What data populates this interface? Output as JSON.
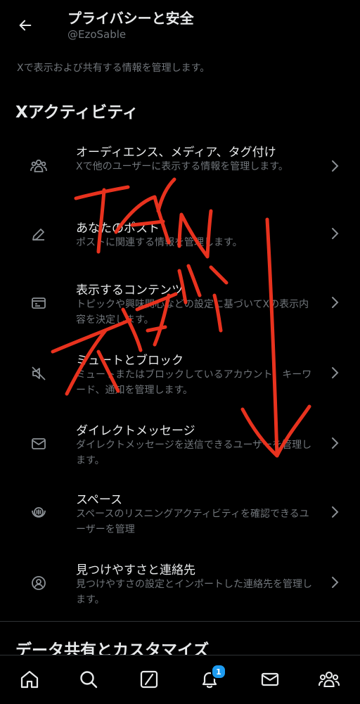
{
  "header": {
    "title": "プライバシーと安全",
    "handle": "@EzoSable"
  },
  "page_description": "Xで表示および共有する情報を管理します。",
  "sections": {
    "activity_title": "Xアクティビティ",
    "data_sharing_title": "データ共有とカスタマイズ"
  },
  "items": [
    {
      "label": "オーディエンス、メディア、タグ付け",
      "desc": "Xで他のユーザーに表示する情報を管理します。",
      "icon": "people-icon"
    },
    {
      "label": "あなたのポスト",
      "desc": "ポストに関連する情報を管理します。",
      "icon": "pencil-icon"
    },
    {
      "label": "表示するコンテンツ",
      "desc": "トピックや興味関心などの設定に基づいてXの表示内容を決定します。",
      "icon": "content-icon"
    },
    {
      "label": "ミュートとブロック",
      "desc": "ミュートまたはブロックしているアカウント、キーワード、通知を管理します。",
      "icon": "mute-icon"
    },
    {
      "label": "ダイレクトメッセージ",
      "desc": "ダイレクトメッセージを送信できるユーザーを管理します。",
      "icon": "envelope-icon"
    },
    {
      "label": "スペース",
      "desc": "スペースのリスニングアクティビティを確認できるユーザーを管理",
      "icon": "spaces-icon"
    },
    {
      "label": "見つけやすさと連絡先",
      "desc": "見つけやすさの設定とインポートした連絡先を管理します。",
      "icon": "contacts-icon"
    }
  ],
  "bottom_nav": {
    "notification_count": "1",
    "items": [
      "home-icon",
      "search-icon",
      "compose-icon",
      "bell-icon",
      "mail-icon",
      "communities-icon"
    ]
  },
  "colors": {
    "background": "#000000",
    "text_primary": "#e7e9ea",
    "text_secondary": "#71767b",
    "accent": "#1d9bf0",
    "annotation_red": "#e8321e"
  }
}
